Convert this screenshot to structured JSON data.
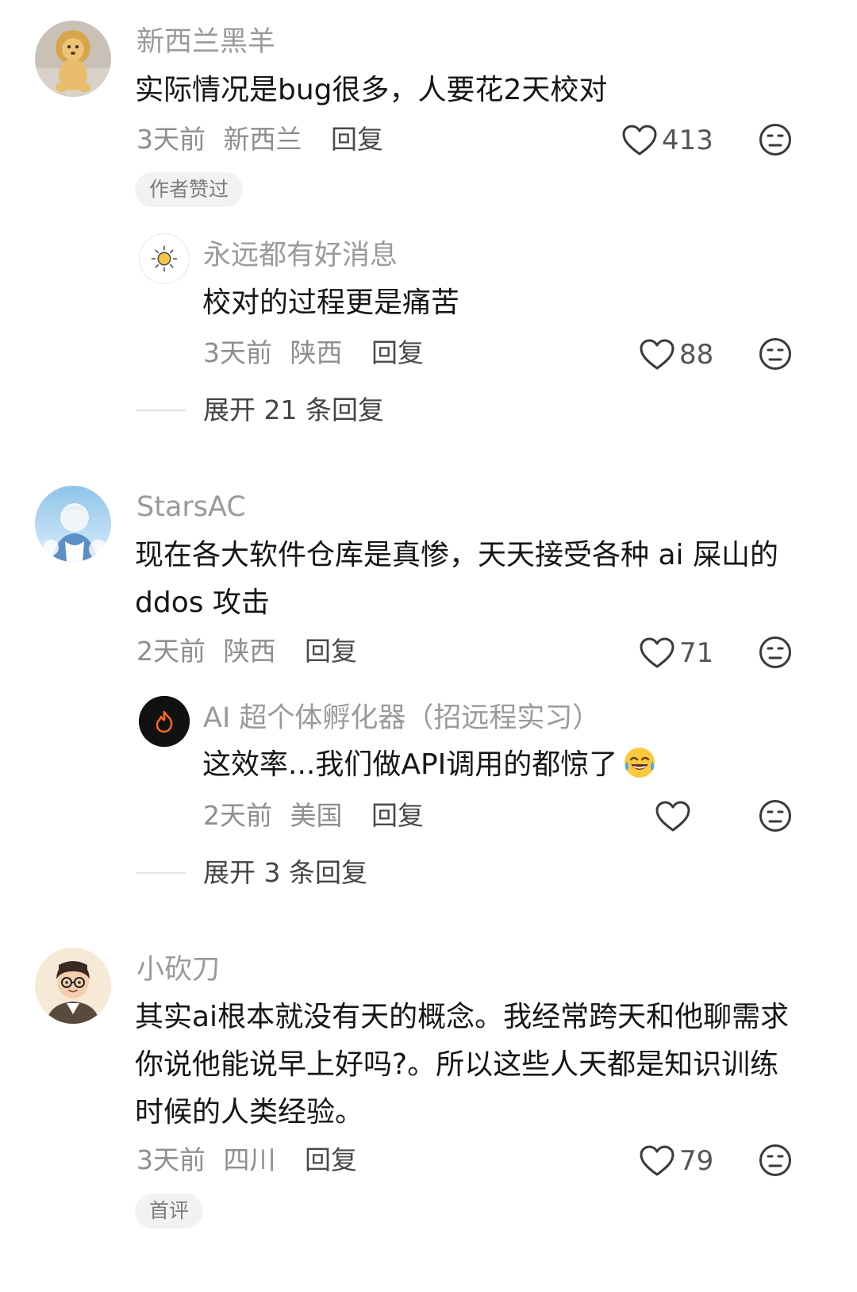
{
  "comments": [
    {
      "username": "新西兰黑羊",
      "avatar": "lion-plush-avatar",
      "content": "实际情况是bug很多，人要花2天校对",
      "time": "3天前",
      "location": "新西兰",
      "reply_label": "回复",
      "likes": "413",
      "tag": "作者赞过",
      "replies": [
        {
          "username": "永远都有好消息",
          "avatar": "sun-avatar",
          "content": "校对的过程更是痛苦",
          "time": "3天前",
          "location": "陕西",
          "reply_label": "回复",
          "likes": "88"
        }
      ],
      "expand_label": "展开 21 条回复"
    },
    {
      "username": "StarsAC",
      "avatar": "anime-boy-avatar",
      "content": "现在各大软件仓库是真惨，天天接受各种 ai 屎山的 ddos 攻击",
      "time": "2天前",
      "location": "陕西",
      "reply_label": "回复",
      "likes": "71",
      "replies": [
        {
          "username": "AI 超个体孵化器（招远程实习）",
          "avatar": "flame-avatar",
          "content": "这效率...我们做API调用的都惊了",
          "emoji": "laughing-tears-emoji",
          "time": "2天前",
          "location": "美国",
          "reply_label": "回复",
          "likes": ""
        }
      ],
      "expand_label": "展开 3 条回复"
    },
    {
      "username": "小砍刀",
      "avatar": "cartoon-boy-avatar",
      "content": "其实ai根本就没有天的概念。我经常跨天和他聊需求你说他能说早上好吗?。所以这些人天都是知识训练时候的人类经验。",
      "time": "3天前",
      "location": "四川",
      "reply_label": "回复",
      "likes": "79",
      "tag": "首评"
    }
  ],
  "icons": {
    "like": "heart-outline-icon",
    "dislike": "meh-face-icon"
  },
  "colors": {
    "username": "#9a9a9a",
    "content": "#161616",
    "meta": "#8e8e8e",
    "tag_bg": "#f2f2f2"
  }
}
